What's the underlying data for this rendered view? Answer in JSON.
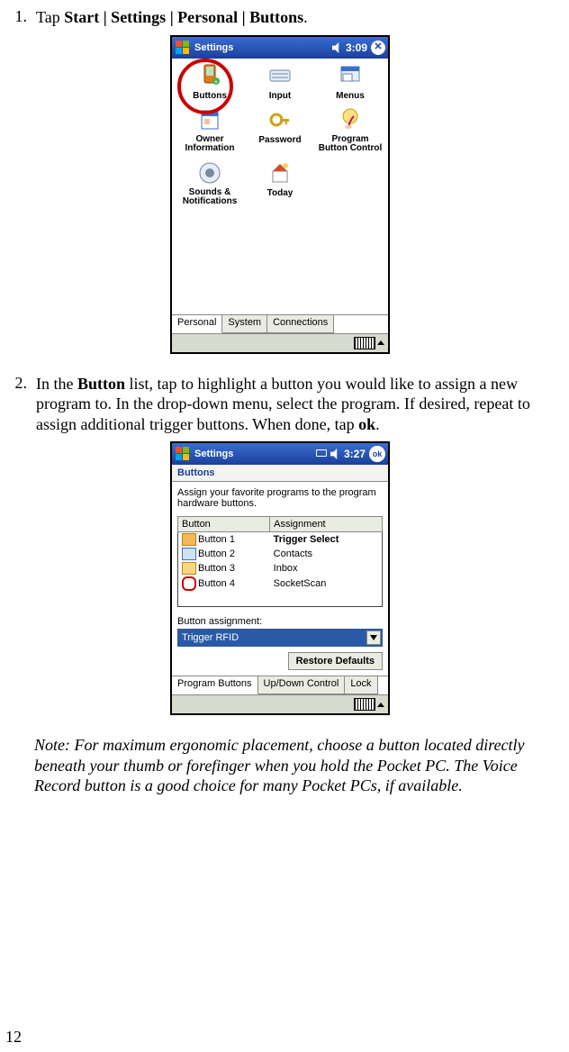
{
  "step1": {
    "num": "1.",
    "prefix": "Tap ",
    "path": "Start | Settings | Personal | Buttons",
    "suffix": "."
  },
  "step2": {
    "num": "2.",
    "t1": "In the ",
    "bold1": "Button",
    "t2": " list, tap to highlight a button you would like to assign a new program to. In the drop-down menu, select the program. If desired, repeat to assign additional trigger buttons. When done, tap ",
    "bold2": "ok",
    "t3": "."
  },
  "note": "Note: For maximum ergonomic placement, choose a button located directly beneath your thumb or forefinger when you hold the Pocket PC. The Voice Record button is a good choice for many Pocket PCs, if available.",
  "page_num": "12",
  "screen1": {
    "title": "Settings",
    "time": "3:09",
    "icons": [
      "Buttons",
      "Input",
      "Menus",
      "Owner Information",
      "Password",
      "Program Button Control",
      "Sounds & Notifications",
      "Today"
    ],
    "tabs": [
      "Personal",
      "System",
      "Connections"
    ]
  },
  "screen2": {
    "title": "Settings",
    "time": "3:27",
    "ok": "ok",
    "subhead": "Buttons",
    "instr": "Assign your favorite programs to the program hardware buttons.",
    "col1": "Button",
    "col2": "Assignment",
    "rows": [
      {
        "b": "Button 1",
        "a": "Trigger Select"
      },
      {
        "b": "Button 2",
        "a": "Contacts"
      },
      {
        "b": "Button 3",
        "a": "Inbox"
      },
      {
        "b": "Button 4",
        "a": "SocketScan"
      }
    ],
    "assign_label": "Button assignment:",
    "dropdown": "Trigger RFID",
    "restore": "Restore Defaults",
    "tabs": [
      "Program Buttons",
      "Up/Down Control",
      "Lock"
    ]
  }
}
